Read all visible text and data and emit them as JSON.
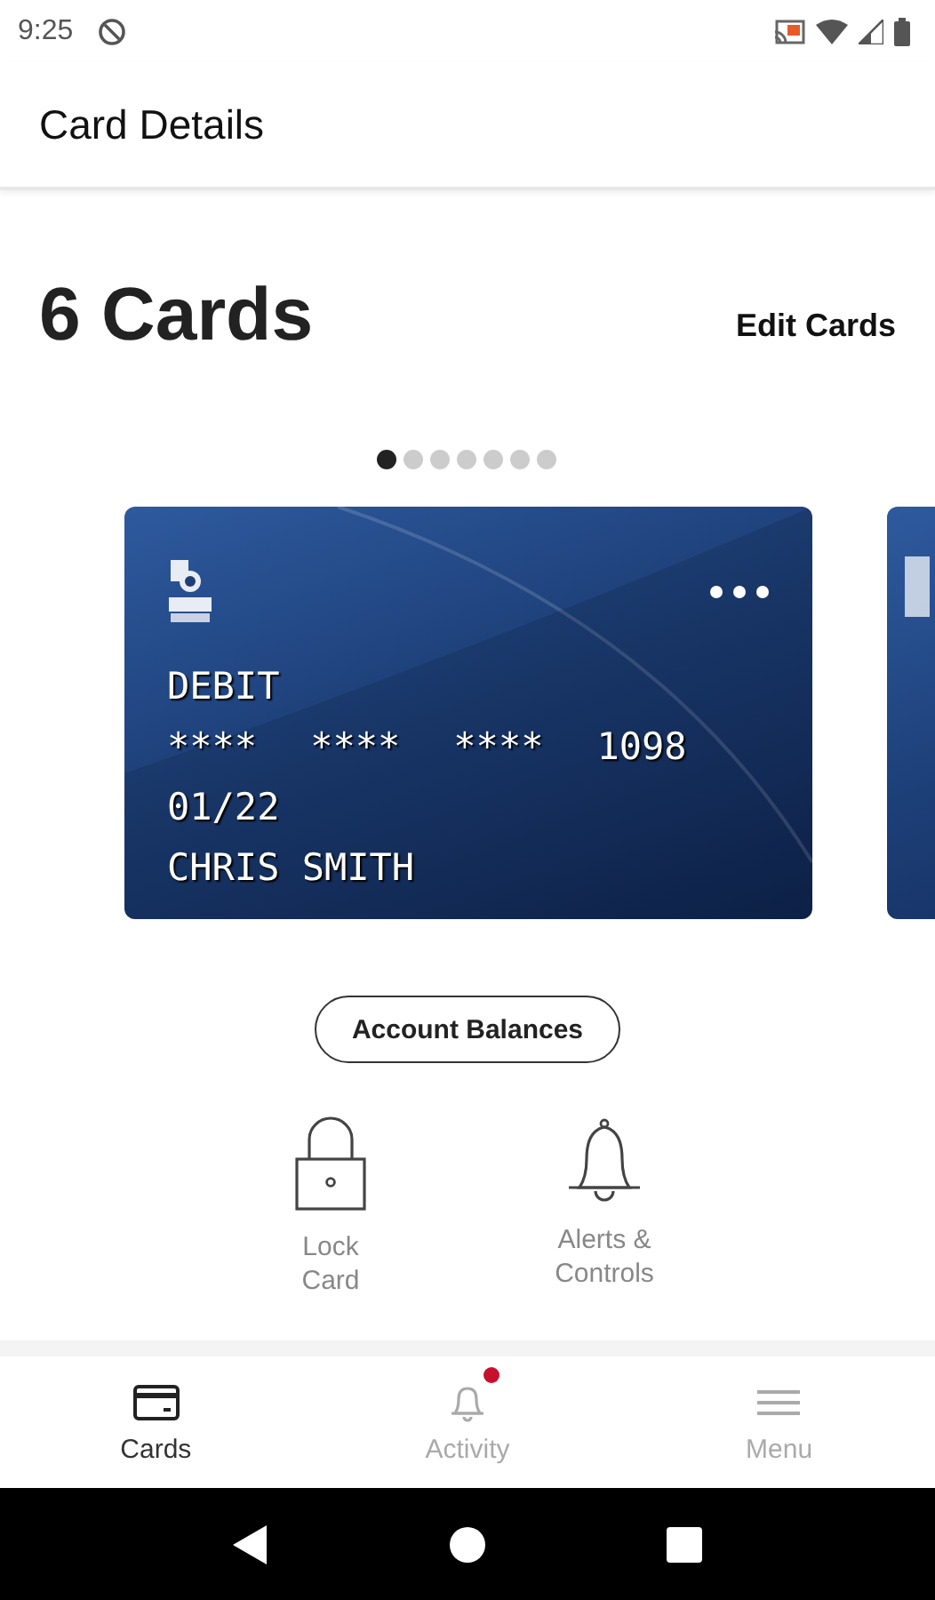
{
  "status_bar": {
    "time": "9:25"
  },
  "header": {
    "title": "Card Details"
  },
  "summary": {
    "count_title": "6 Cards",
    "edit_label": "Edit Cards"
  },
  "pager": [
    {
      "selected": true
    },
    {
      "selected": false
    },
    {
      "selected": false
    },
    {
      "selected": false
    },
    {
      "selected": false
    },
    {
      "selected": false
    },
    {
      "selected": false
    }
  ],
  "cards": [
    {
      "type": "DEBIT",
      "groups": [
        "****",
        "****",
        "****",
        "1098"
      ],
      "expiry": "01/22",
      "holder": "CHRIS SMITH"
    },
    {
      "kind": "partial"
    }
  ],
  "balance_button": "Account Balances",
  "actions": [
    {
      "kind": "lock",
      "label": "Lock\nCard"
    },
    {
      "kind": "bell",
      "label": "Alerts &\nControls"
    }
  ],
  "tabs": [
    {
      "kind": "card",
      "label": "Cards",
      "selected": true,
      "badge": false
    },
    {
      "kind": "bell",
      "label": "Activity",
      "selected": false,
      "badge": true
    },
    {
      "kind": "menu",
      "label": "Menu",
      "selected": false,
      "badge": false
    }
  ]
}
